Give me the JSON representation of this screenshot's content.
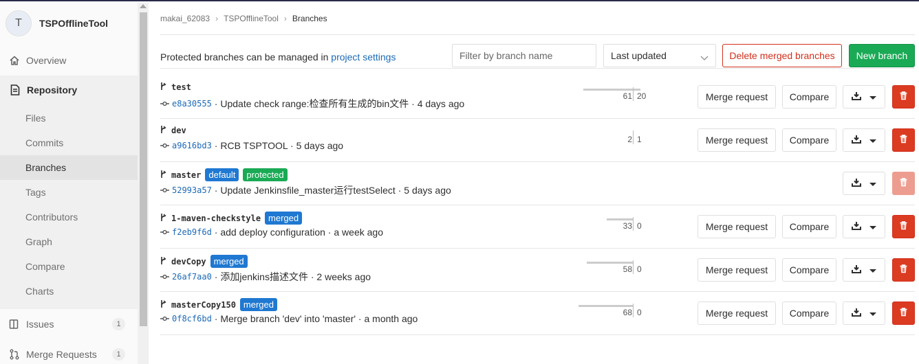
{
  "sidebar": {
    "project_initial": "T",
    "project_name": "TSPOfflineTool",
    "overview": "Overview",
    "repository": "Repository",
    "sub_items": [
      "Files",
      "Commits",
      "Branches",
      "Tags",
      "Contributors",
      "Graph",
      "Compare",
      "Charts"
    ],
    "active_sub_item": "Branches",
    "issues": "Issues",
    "issues_count": "1",
    "merge_requests": "Merge Requests",
    "merge_requests_count": "1"
  },
  "breadcrumb": [
    "makai_62083",
    "TSPOfflineTool",
    "Branches"
  ],
  "toolbar": {
    "protected_text": "Protected branches can be managed in ",
    "protected_link": "project settings",
    "filter_placeholder": "Filter by branch name",
    "sort_value": "Last updated",
    "delete_merged_label": "Delete merged branches",
    "new_branch_label": "New branch"
  },
  "actions": {
    "merge_request_label": "Merge request",
    "compare_label": "Compare"
  },
  "branches": [
    {
      "name": "test",
      "badges": [],
      "sha": "e8a30555",
      "message": "Update check range:检查所有生成的bin文件",
      "time": "4 days ago",
      "behind": "61",
      "ahead": "20",
      "behind_frac": 0.75,
      "ahead_frac": 0.25,
      "deletable": true,
      "has_mr": true
    },
    {
      "name": "dev",
      "badges": [],
      "sha": "a9616bd3",
      "message": "RCB TSPTOOL",
      "time": "5 days ago",
      "behind": "2",
      "ahead": "1",
      "behind_frac": 0.0,
      "ahead_frac": 0.0,
      "deletable": true,
      "has_mr": true
    },
    {
      "name": "master",
      "badges": [
        {
          "label": "default",
          "color": "#1f78d1"
        },
        {
          "label": "protected",
          "color": "#1aaa55"
        }
      ],
      "sha": "52993a57",
      "message": "Update Jenkinsfile_master运行testSelect",
      "time": "5 days ago",
      "behind": "",
      "ahead": "",
      "deletable": false,
      "has_mr": false
    },
    {
      "name": "1-maven-checkstyle",
      "badges": [
        {
          "label": "merged",
          "color": "#1f78d1"
        }
      ],
      "sha": "f2eb9f6d",
      "message": "add deploy configuration",
      "time": "a week ago",
      "behind": "33",
      "ahead": "0",
      "behind_frac": 0.4,
      "ahead_frac": 0,
      "deletable": true,
      "has_mr": true
    },
    {
      "name": "devCopy",
      "badges": [
        {
          "label": "merged",
          "color": "#1f78d1"
        }
      ],
      "sha": "26af7aa0",
      "message": "添加jenkins描述文件",
      "time": "2 weeks ago",
      "behind": "58",
      "ahead": "0",
      "behind_frac": 0.7,
      "ahead_frac": 0,
      "deletable": true,
      "has_mr": true
    },
    {
      "name": "masterCopy150",
      "badges": [
        {
          "label": "merged",
          "color": "#1f78d1"
        }
      ],
      "sha": "0f8cf6bd",
      "message": "Merge branch 'dev' into 'master'",
      "time": "a month ago",
      "behind": "68",
      "ahead": "0",
      "behind_frac": 0.82,
      "ahead_frac": 0,
      "deletable": true,
      "has_mr": true
    }
  ]
}
